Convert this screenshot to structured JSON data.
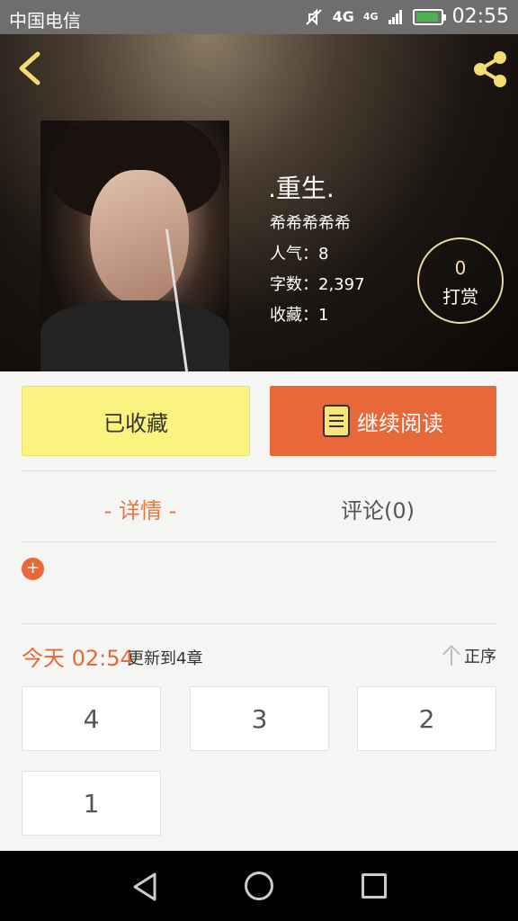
{
  "status_bar": {
    "carrier": "中国电信",
    "network": "4G",
    "network_small": "4G",
    "time": "02:55"
  },
  "header": {
    "back_icon": "back-arrow-icon",
    "share_icon": "share-icon",
    "title": ".重生.",
    "author": "希希希希希",
    "popularity_label": "人气：",
    "popularity": "8",
    "words_label": "字数：",
    "words": "2,397",
    "favorites_label": "收藏：",
    "favorites": "1",
    "tip_count": "0",
    "tip_label": "打赏"
  },
  "actions": {
    "favorite_label": "已收藏",
    "read_label": "继续阅读"
  },
  "tabs": {
    "detail": "- 详情 -",
    "comments": "评论(0)"
  },
  "update": {
    "today": "今天 02:54",
    "text": "更新到4章",
    "sort_label": "正序"
  },
  "chapters": [
    "4",
    "3",
    "2",
    "1"
  ],
  "colors": {
    "accent": "#e8683a",
    "favorite_bg": "#fbf37f",
    "background": "#f5f5f3"
  }
}
